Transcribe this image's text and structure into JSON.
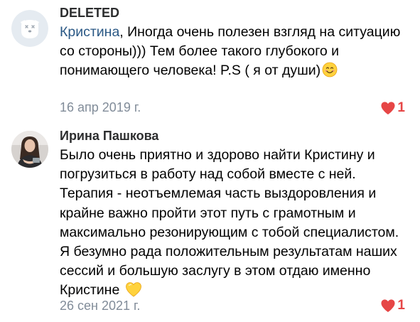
{
  "comments": [
    {
      "author": "DELETED",
      "mention": "Кристина",
      "text": ", Иногда очень полезен взгляд на ситуацию со стороны))) Тем более такого глубокого и понимающего человека! P.S ( я от души)",
      "emoji": "smiling-face-icon",
      "date": "16 апр 2019 г.",
      "likes": "1"
    },
    {
      "author": "Ирина Пашкова",
      "text": "Было очень приятно и здорово найти Кристину и погрузиться в работу над собой вместе с ней. Терапия - неотъемлемая часть выздоровления и крайне важно пройти этот путь с грамотным и максимально резонирующим с тобой специалистом. Я безумно рада положительным результатам наших сессий и большую заслугу в этом отдаю именно Кристине",
      "emoji": "yellow-heart-icon",
      "date": "26 сен 2021 г.",
      "likes": "1"
    }
  ],
  "colors": {
    "mention": "#2a5885",
    "secondary_text": "#818c99",
    "like_red": "#e64646",
    "emoji_yellow": "#ffd23d",
    "deleted_avatar_bg": "#e5ebf1"
  }
}
